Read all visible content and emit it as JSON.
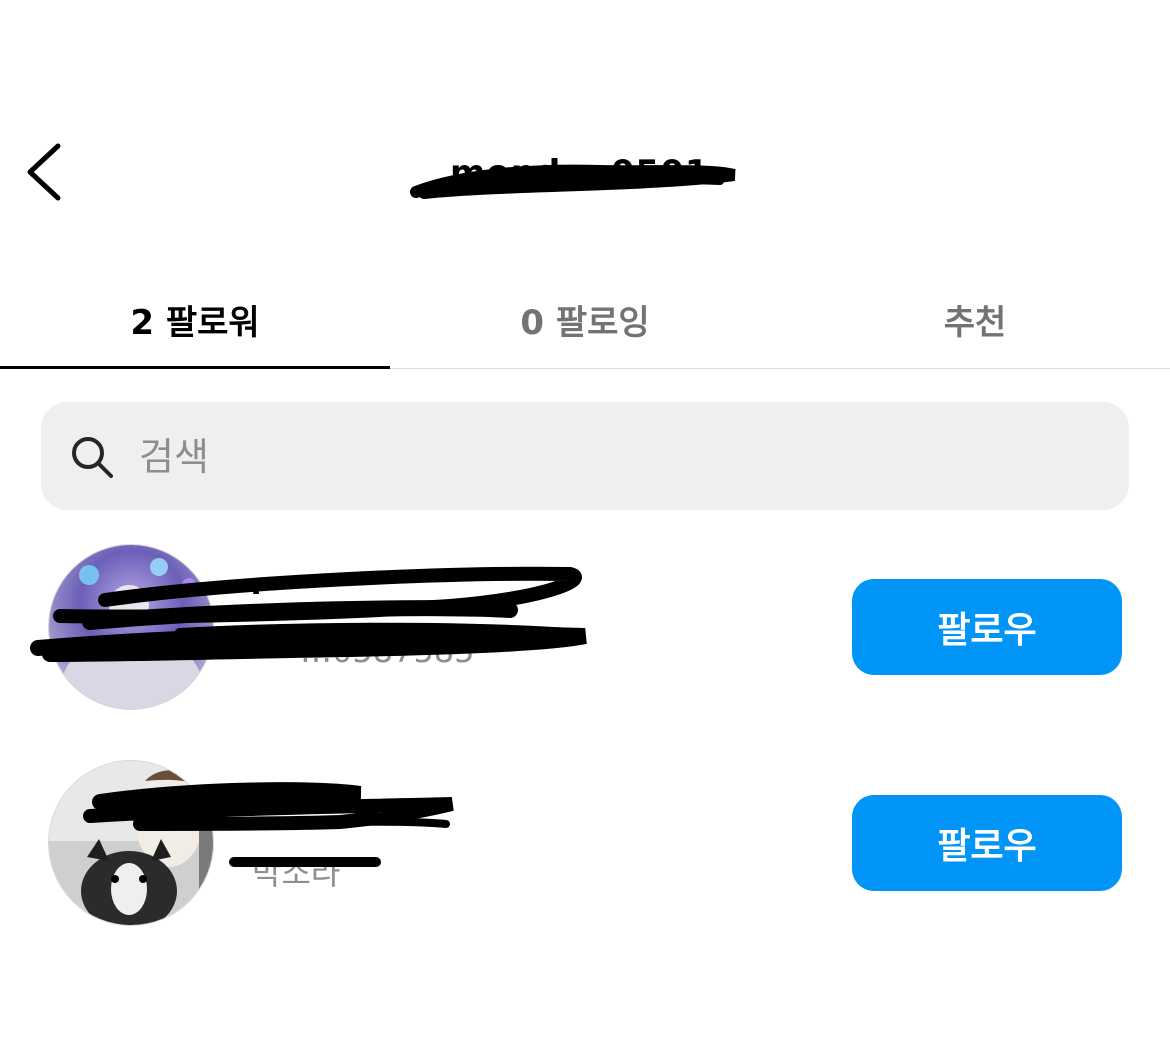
{
  "header": {
    "title": "mondon0501",
    "back_icon": "chevron-left-icon"
  },
  "tabs": [
    {
      "label": "2 팔로워",
      "active": true
    },
    {
      "label": "0 팔로잉",
      "active": false
    },
    {
      "label": "추천",
      "active": false
    }
  ],
  "search": {
    "placeholder": "검색",
    "value": "",
    "icon": "search-icon"
  },
  "followers": [
    {
      "username": "·",
      "full_name": "…0587585",
      "button_label": "팔로우"
    },
    {
      "username": "·",
      "full_name": "박소라",
      "button_label": "팔로우"
    }
  ],
  "colors": {
    "accent": "#0095f6",
    "search_bg": "#efefef",
    "muted_text": "#737373",
    "divider": "#dbdbdb"
  }
}
